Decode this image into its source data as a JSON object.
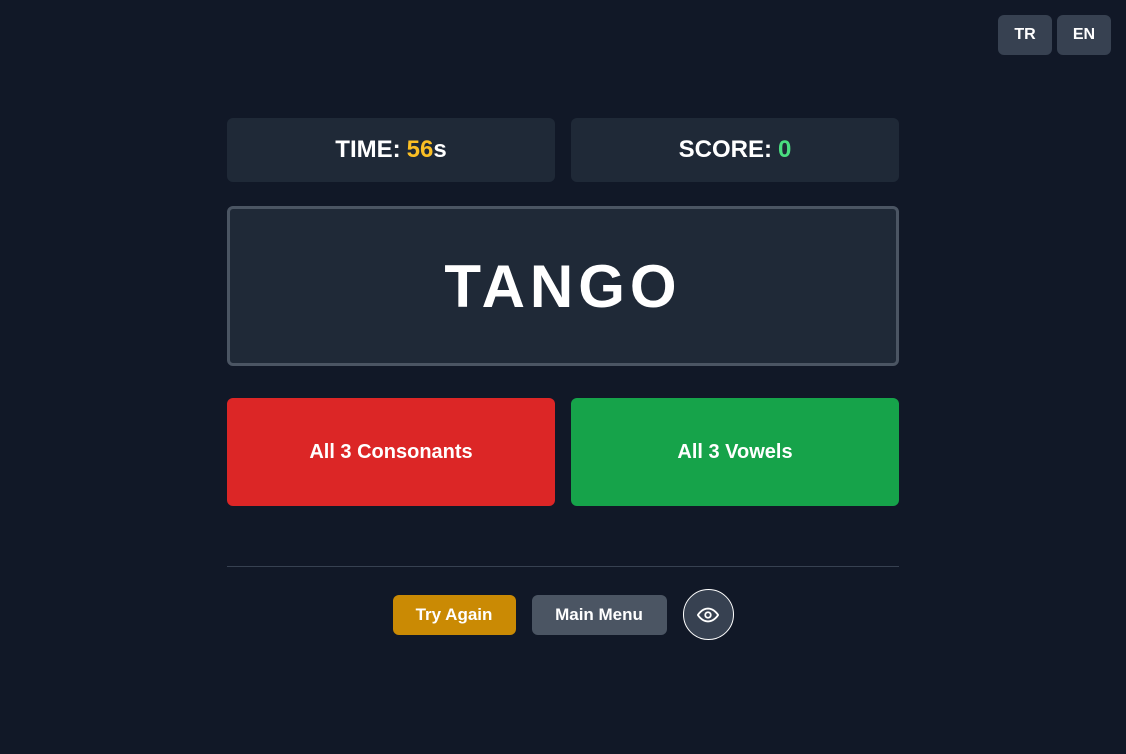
{
  "language_switch": {
    "items": [
      {
        "label": "TR"
      },
      {
        "label": "EN"
      }
    ]
  },
  "stats": {
    "time_label": "TIME:",
    "time_value": "56",
    "time_unit": "s",
    "score_label": "SCORE:",
    "score_value": "0"
  },
  "word": "TANGO",
  "answers": {
    "consonants_label": "All 3 Consonants",
    "vowels_label": "All 3 Vowels"
  },
  "actions": {
    "try_again_label": "Try Again",
    "main_menu_label": "Main Menu",
    "eye_icon": "eye-icon"
  },
  "colors": {
    "background": "#111827",
    "panel": "#1f2937",
    "time_accent": "#fbbf24",
    "score_accent": "#4ade80",
    "consonants": "#dc2626",
    "vowels": "#16a34a",
    "try_again": "#ca8a04",
    "main_menu": "#4b5563"
  }
}
